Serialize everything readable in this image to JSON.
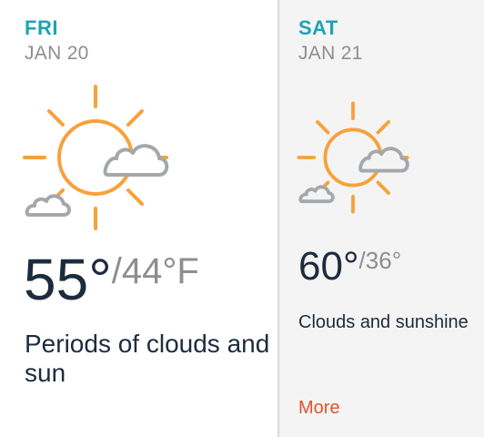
{
  "colors": {
    "day_accent": "#1fa3b3",
    "sun": "#f7a13c",
    "cloud": "#a4a7ab",
    "more_link": "#e2532a"
  },
  "days": [
    {
      "name": "FRI",
      "date": "JAN 20",
      "icon": "partly-sunny-icon",
      "high": "55°",
      "low": "/44°F",
      "description": "Periods of clouds and sun"
    },
    {
      "name": "SAT",
      "date": "JAN 21",
      "icon": "partly-sunny-icon",
      "high": "60°",
      "low": "/36°",
      "description": "Clouds and sunshine",
      "more_label": "More"
    }
  ]
}
